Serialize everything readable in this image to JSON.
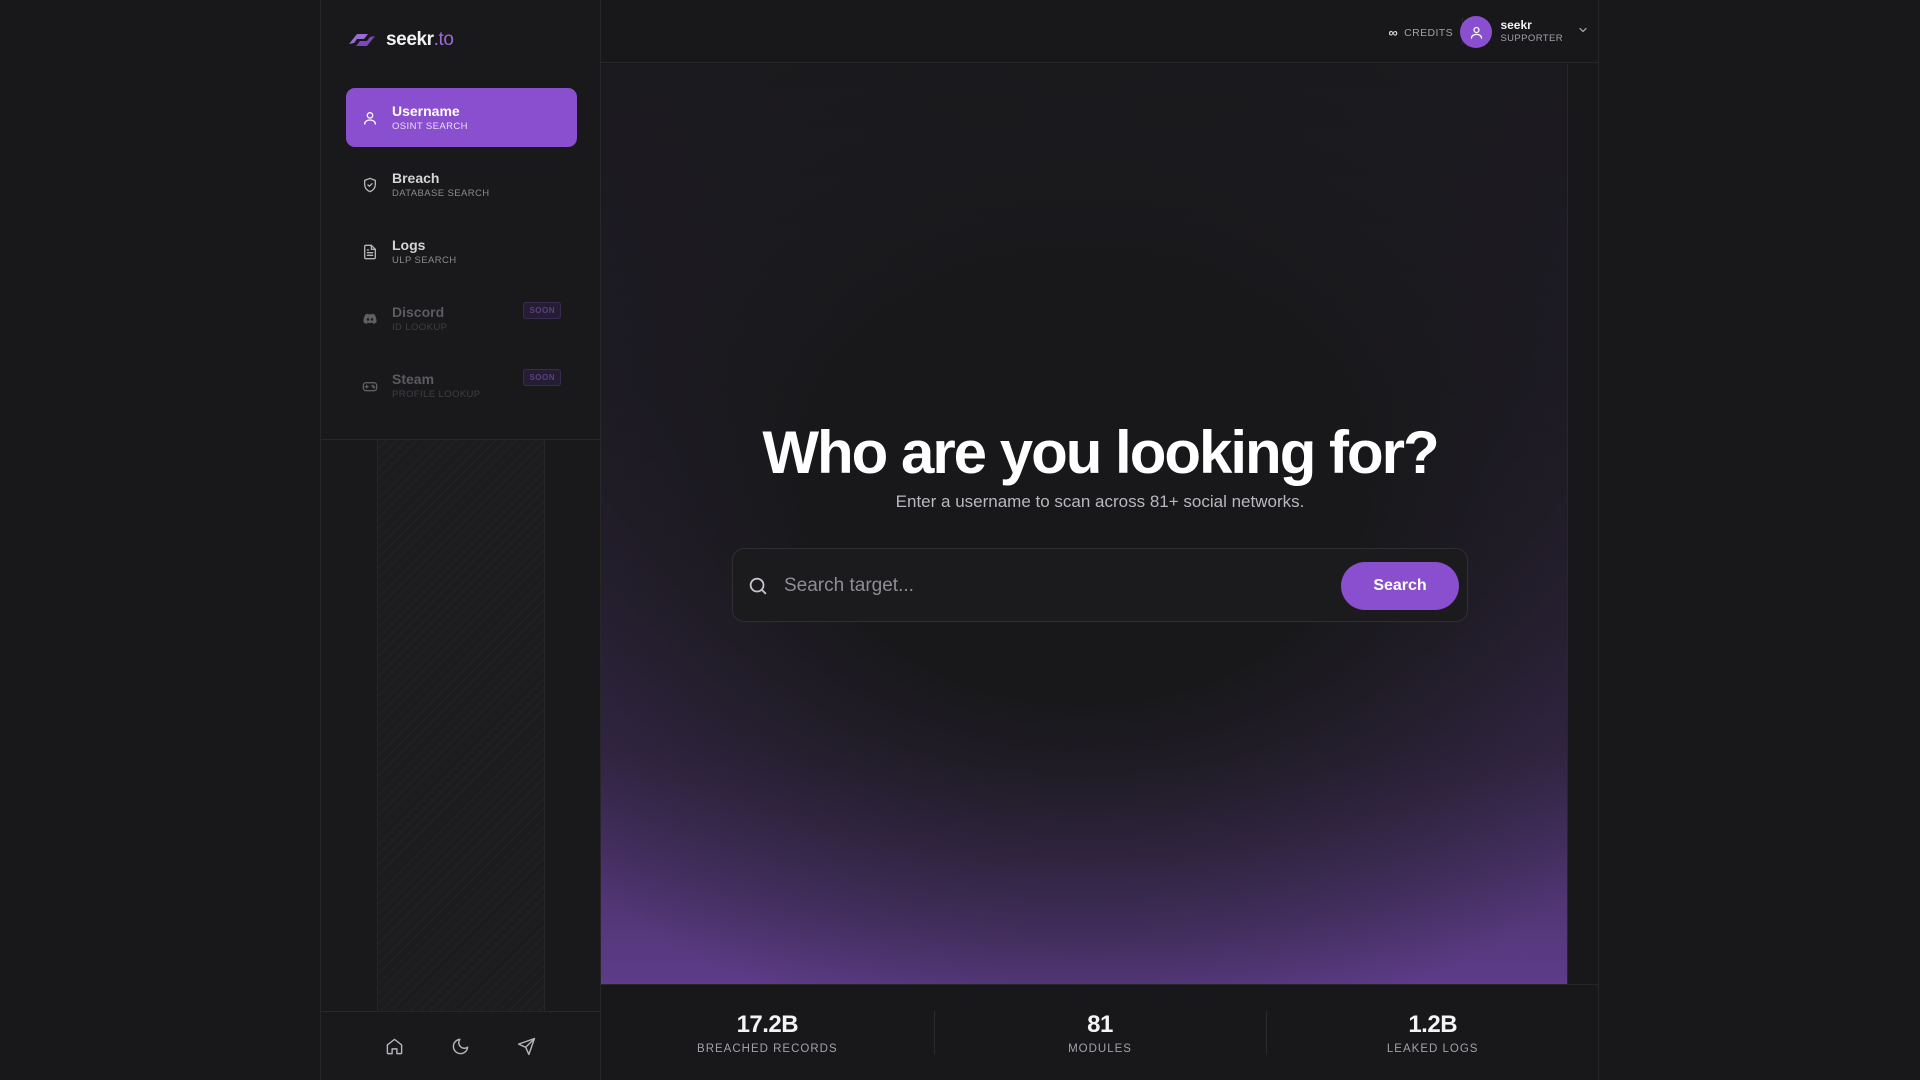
{
  "brand": {
    "name": "seekr",
    "tld": ".to"
  },
  "colors": {
    "accent": "#8a4fcf",
    "background": "#18181a"
  },
  "nav": [
    {
      "label": "Username",
      "sublabel": "OSINT SEARCH",
      "icon": "user-icon",
      "active": true
    },
    {
      "label": "Breach",
      "sublabel": "DATABASE SEARCH",
      "icon": "shield-icon"
    },
    {
      "label": "Logs",
      "sublabel": "ULP SEARCH",
      "icon": "document-icon"
    },
    {
      "label": "Discord",
      "sublabel": "ID LOOKUP",
      "icon": "discord-icon",
      "badge": "SOON"
    },
    {
      "label": "Steam",
      "sublabel": "PROFILE LOOKUP",
      "icon": "gamepad-icon",
      "badge": "SOON"
    }
  ],
  "footer_icons": [
    "home-icon",
    "moon-icon",
    "send-icon"
  ],
  "topbar": {
    "credits_symbol": "∞",
    "credits_label": "CREDITS",
    "user": {
      "name": "seekr",
      "role": "SUPPORTER"
    }
  },
  "hero": {
    "title": "Who are you looking for?",
    "subtitle": "Enter a username to scan across 81+ social networks."
  },
  "search": {
    "placeholder": "Search target...",
    "value": "",
    "button_label": "Search"
  },
  "stats": [
    {
      "value": "17.2B",
      "label": "BREACHED RECORDS"
    },
    {
      "value": "81",
      "label": "MODULES"
    },
    {
      "value": "1.2B",
      "label": "LEAKED LOGS"
    }
  ]
}
